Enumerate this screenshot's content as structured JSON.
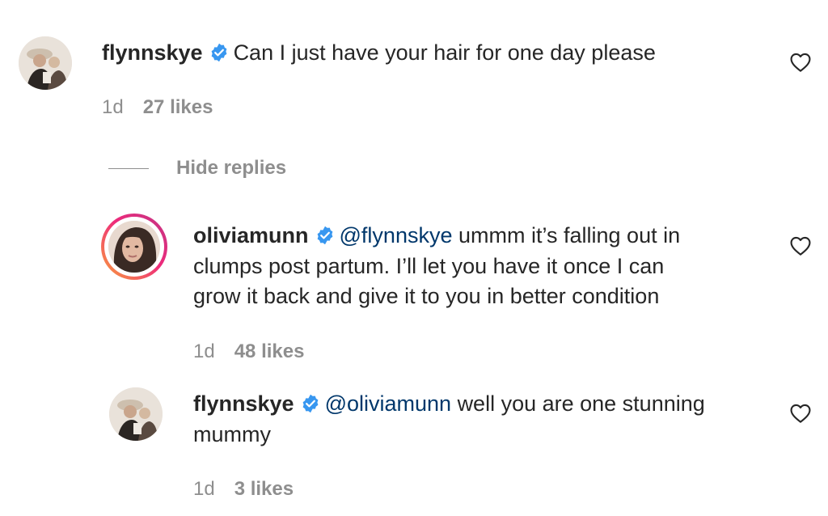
{
  "comments": [
    {
      "username": "flynnskye",
      "verified": true,
      "mention": "",
      "text": "Can I just have your hair for one day please",
      "time": "1d",
      "likes": "27 likes",
      "avatar_icon": "profile-photo-icon"
    }
  ],
  "replies_toggle": {
    "label": "Hide replies"
  },
  "replies": [
    {
      "username": "oliviamunn",
      "verified": true,
      "mention": "@flynnskye",
      "text_line1": "ummm it’s falling out in",
      "text_line2": "clumps post partum. I’ll let you have it once I can",
      "text_line3": "grow it back and give it to you in better condition",
      "time": "1d",
      "likes": "48 likes",
      "has_story_ring": true
    },
    {
      "username": "flynnskye",
      "verified": true,
      "mention": "@oliviamunn",
      "text_line1": "well you are one stunning",
      "text_line2": "mummy",
      "time": "1d",
      "likes": "3 likes",
      "has_story_ring": false
    }
  ],
  "colors": {
    "text": "#262626",
    "secondary": "#8e8e8e",
    "mention": "#00376b",
    "verified": "#3897f0"
  }
}
